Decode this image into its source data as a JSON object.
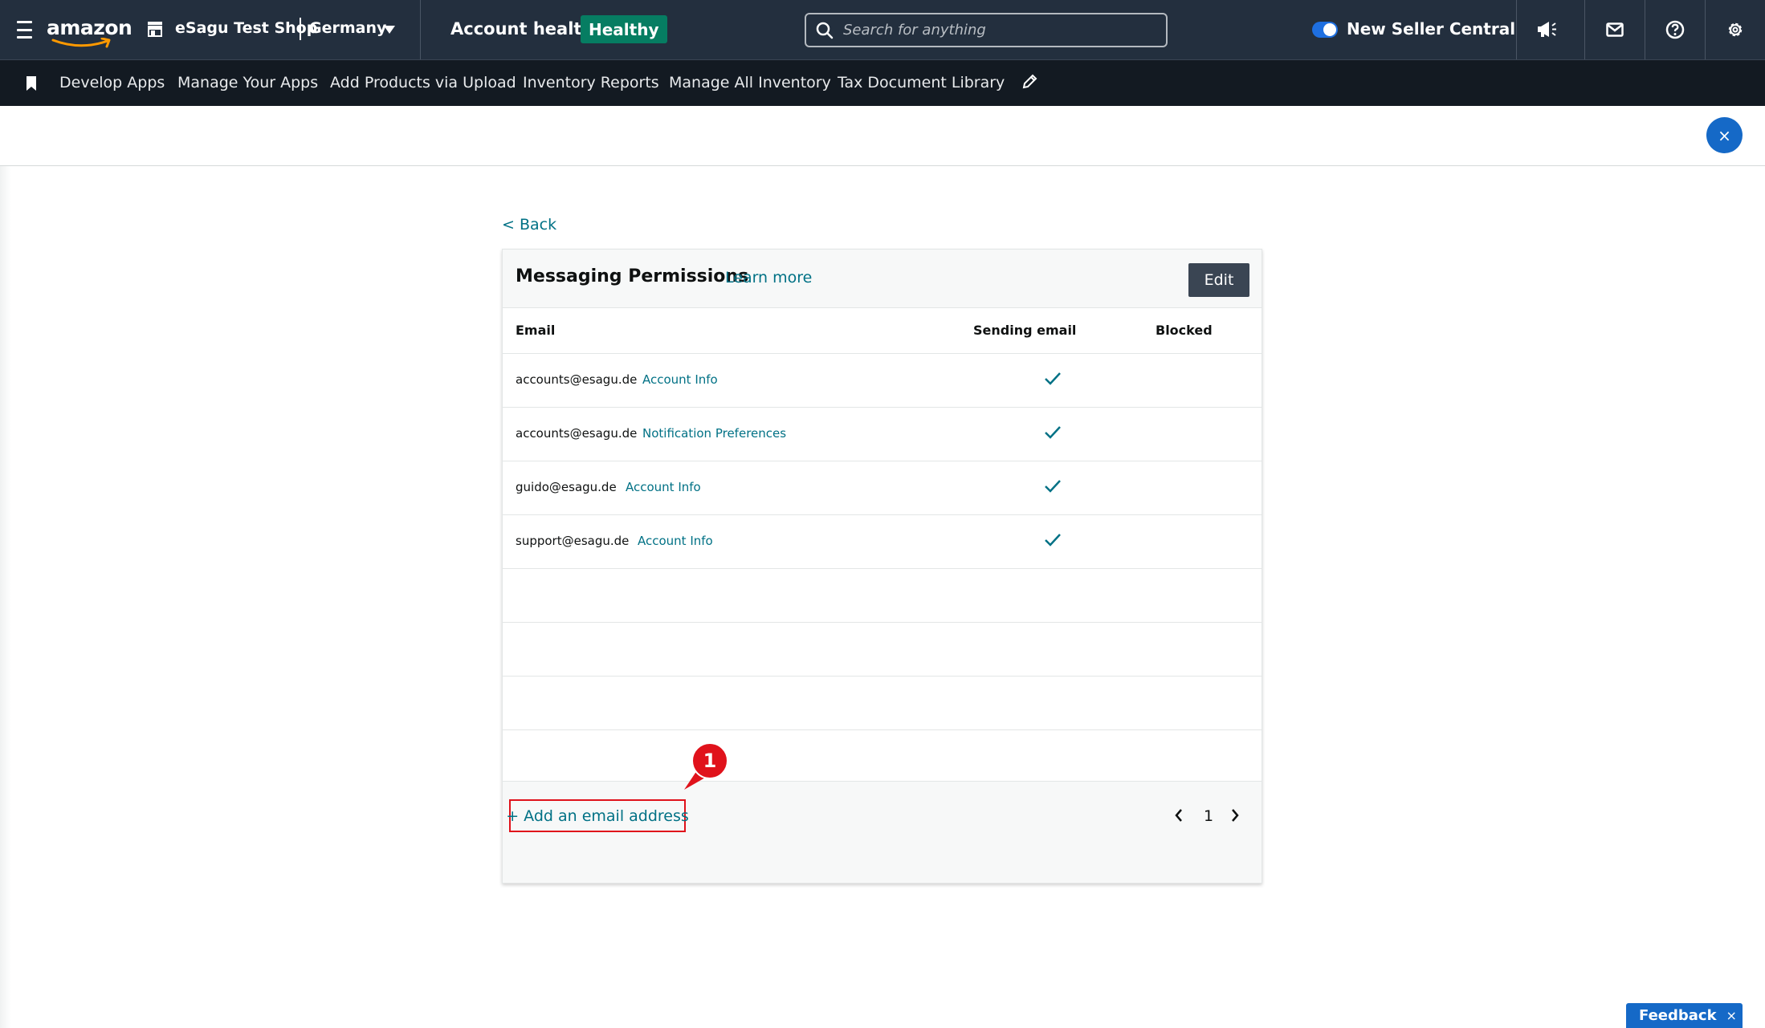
{
  "header": {
    "logo_text": "amazon",
    "shop_name": "eSagu Test Shop",
    "country": "Germany",
    "account_health_label": "Account health",
    "account_health_status": "Healthy",
    "search_placeholder": "Search for anything",
    "new_seller_central_label": "New Seller Central",
    "icons": [
      "megaphone-icon",
      "mail-icon",
      "help-icon",
      "gear-icon"
    ]
  },
  "subnav": {
    "items": [
      {
        "label": "Develop Apps"
      },
      {
        "label": "Manage Your Apps"
      },
      {
        "label": "Add Products via Upload"
      },
      {
        "label": "Inventory Reports"
      },
      {
        "label": "Manage All Inventory"
      },
      {
        "label": "Tax Document Library"
      }
    ]
  },
  "close_label": "×",
  "main": {
    "back_label": "< Back",
    "card": {
      "title": "Messaging Permissions",
      "learn_more": "Learn more",
      "edit_label": "Edit",
      "columns": [
        "Email",
        "Sending email",
        "Blocked"
      ],
      "rows": [
        {
          "email": "accounts@esagu.de",
          "link": "Account Info",
          "sending": true,
          "blocked": false
        },
        {
          "email": "accounts@esagu.de",
          "link": "Notification Preferences",
          "sending": true,
          "blocked": false
        },
        {
          "email": "guido@esagu.de",
          "link": "Account Info",
          "sending": true,
          "blocked": false
        },
        {
          "email": "support@esagu.de",
          "link": "Account Info",
          "sending": true,
          "blocked": false
        }
      ],
      "add_email_label": "+ Add an email address",
      "page_number": "1"
    }
  },
  "annotation": {
    "number": "1"
  },
  "feedback": {
    "label": "Feedback",
    "close": "×"
  },
  "colors": {
    "header_bg": "#232f3e",
    "subnav_bg": "#131a22",
    "link": "#007185",
    "healthy_badge": "#067d62",
    "primary_blue": "#1569c7",
    "highlight_red": "#e0121b"
  }
}
